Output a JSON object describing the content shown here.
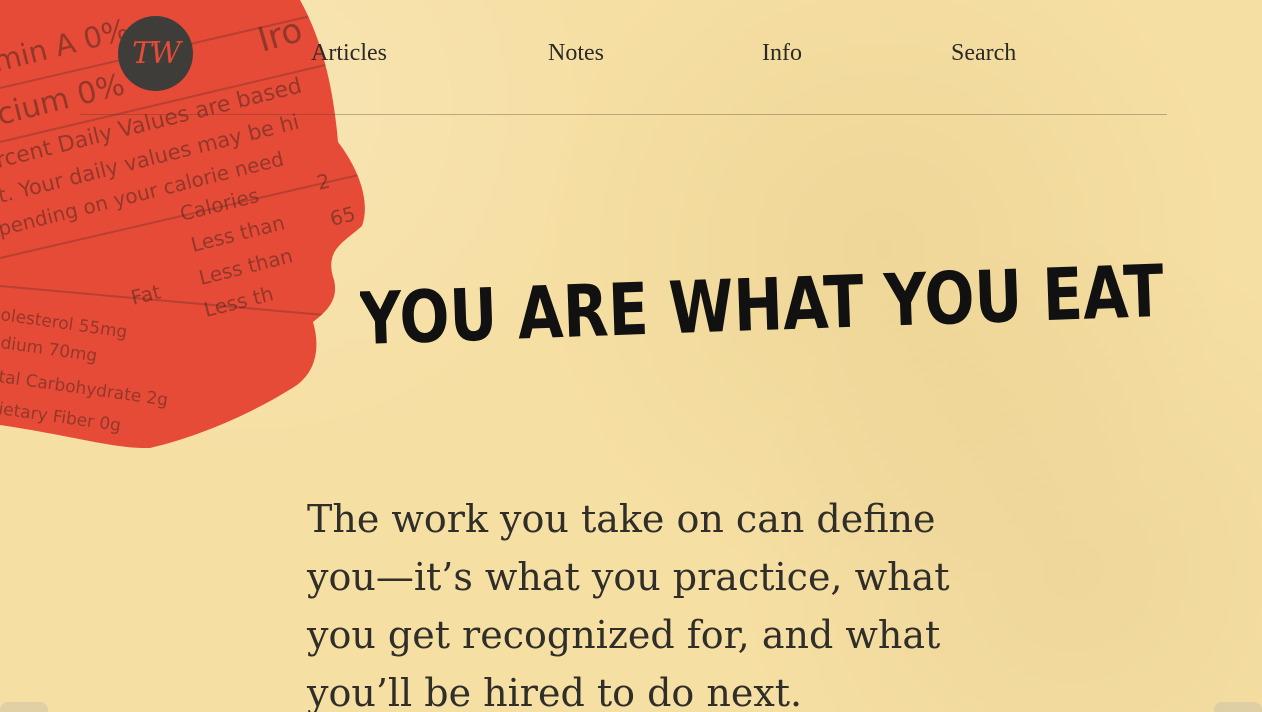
{
  "site": {
    "logo_text": "TW",
    "nav": {
      "items": [
        {
          "label": "Articles"
        },
        {
          "label": "Notes"
        },
        {
          "label": "Info"
        },
        {
          "label": "Search"
        }
      ]
    }
  },
  "hero": {
    "title": "YOU ARE WHAT YOU EAT",
    "label_text": [
      "min A 0%",
      "Iro",
      "cium 0%",
      "rcent Daily Values are based",
      "t. Your daily values may be hi",
      "pending on your calorie need",
      "Calories",
      "2",
      "65",
      "Less than",
      "Less than",
      "Less th",
      "Fat",
      "olesterol 55mg",
      "dium 70mg",
      "tal Carbohydrate 2g",
      "ietary Fiber 0g"
    ]
  },
  "article": {
    "intro": "The work you take on can define you—it’s what you practice, what you get recognized for, and what you’ll be hired to do next."
  },
  "colors": {
    "background": "#f6dfa3",
    "accent": "#e64b38",
    "logo_bg": "#3e3d39",
    "text": "#2b2a26"
  }
}
